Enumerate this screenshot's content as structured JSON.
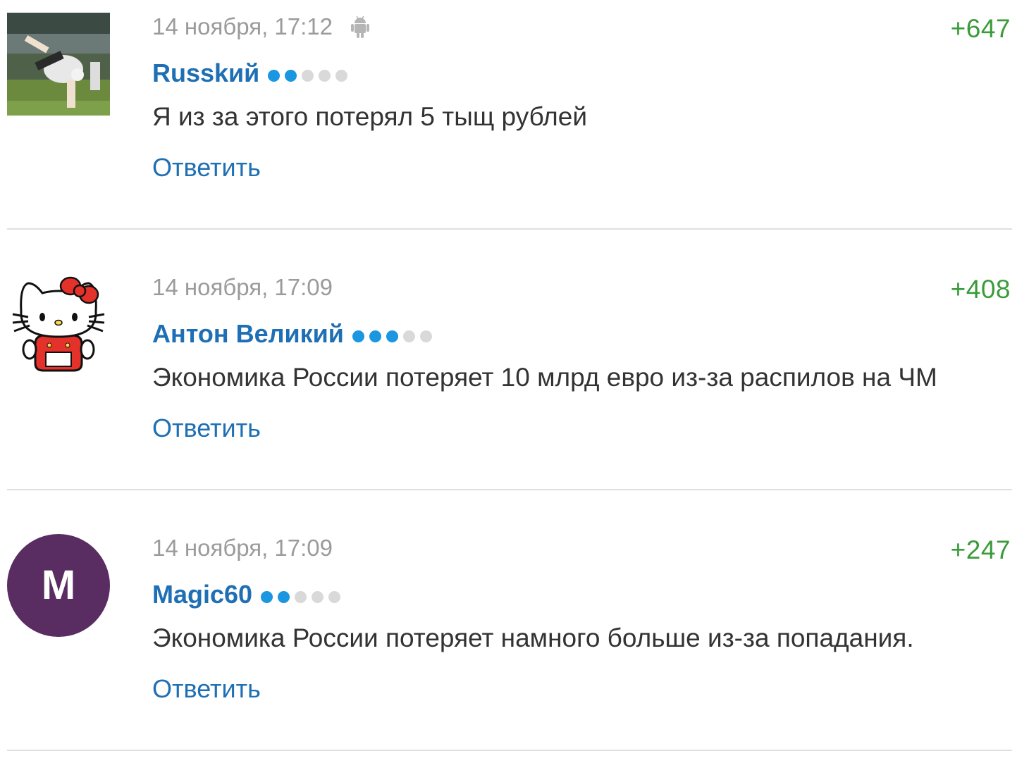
{
  "colors": {
    "author": "#1e6fb4",
    "rating": "#3a9b3a",
    "date": "#9b9b9b",
    "dot_active": "#1b96e0",
    "dot_inactive": "#d9d9d9",
    "avatar_m_bg": "#5a2d62"
  },
  "comments": [
    {
      "date": "14 ноября, 17:12",
      "device_icon": "android-icon",
      "rating": "+647",
      "author": "Russkий",
      "level": {
        "filled": 2,
        "total": 5
      },
      "text": "Я из за этого потерял 5 тыщ рублей",
      "reply_label": "Ответить",
      "avatar": "photo-footballer"
    },
    {
      "date": "14 ноября, 17:09",
      "rating": "+408",
      "author": "Антон Великий",
      "level": {
        "filled": 3,
        "total": 5
      },
      "text": "Экономика России потеряет 10 млрд евро из-за распилов на ЧМ",
      "reply_label": "Ответить",
      "avatar": "hello-kitty-image"
    },
    {
      "date": "14 ноября, 17:09",
      "rating": "+247",
      "author": "Magic60",
      "level": {
        "filled": 2,
        "total": 5
      },
      "text": "Экономика России потеряет намного больше из-за попадания.",
      "reply_label": "Ответить",
      "avatar": "letter-avatar",
      "avatar_letter": "M"
    }
  ]
}
